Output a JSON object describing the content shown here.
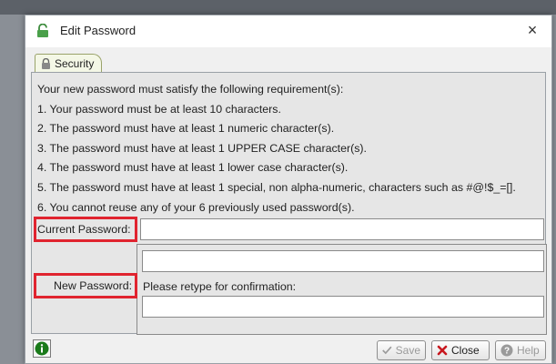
{
  "window": {
    "title": "Edit Password",
    "close_glyph": "×"
  },
  "tab": {
    "label": "Security"
  },
  "requirements": {
    "intro": "Your new password must satisfy the following requirement(s):",
    "items": [
      "1.  Your password must be at least 10 characters.",
      "2.  The password must have at least 1 numeric character(s).",
      "3.  The password must have at least 1 UPPER CASE character(s).",
      "4.  The password must have at least 1 lower case character(s).",
      "5.  The password must have at least 1 special, non alpha-numeric, characters such as #@!$_=[].",
      "6.  You cannot reuse any of your 6 previously used password(s)."
    ]
  },
  "fields": {
    "current_password_label": "Current Password:",
    "current_password_value": "",
    "new_password_label": "New Password:",
    "new_password_value": "",
    "retype_label": "Please retype for confirmation:",
    "retype_value": ""
  },
  "buttons": {
    "save": "Save",
    "close": "Close",
    "help": "Help"
  },
  "colors": {
    "highlight": "#e0242f",
    "info_green": "#1a7a1a",
    "close_red": "#c8171f"
  },
  "icons": [
    "lock-icon",
    "info-icon",
    "checkmark-icon",
    "x-icon",
    "help-icon"
  ]
}
